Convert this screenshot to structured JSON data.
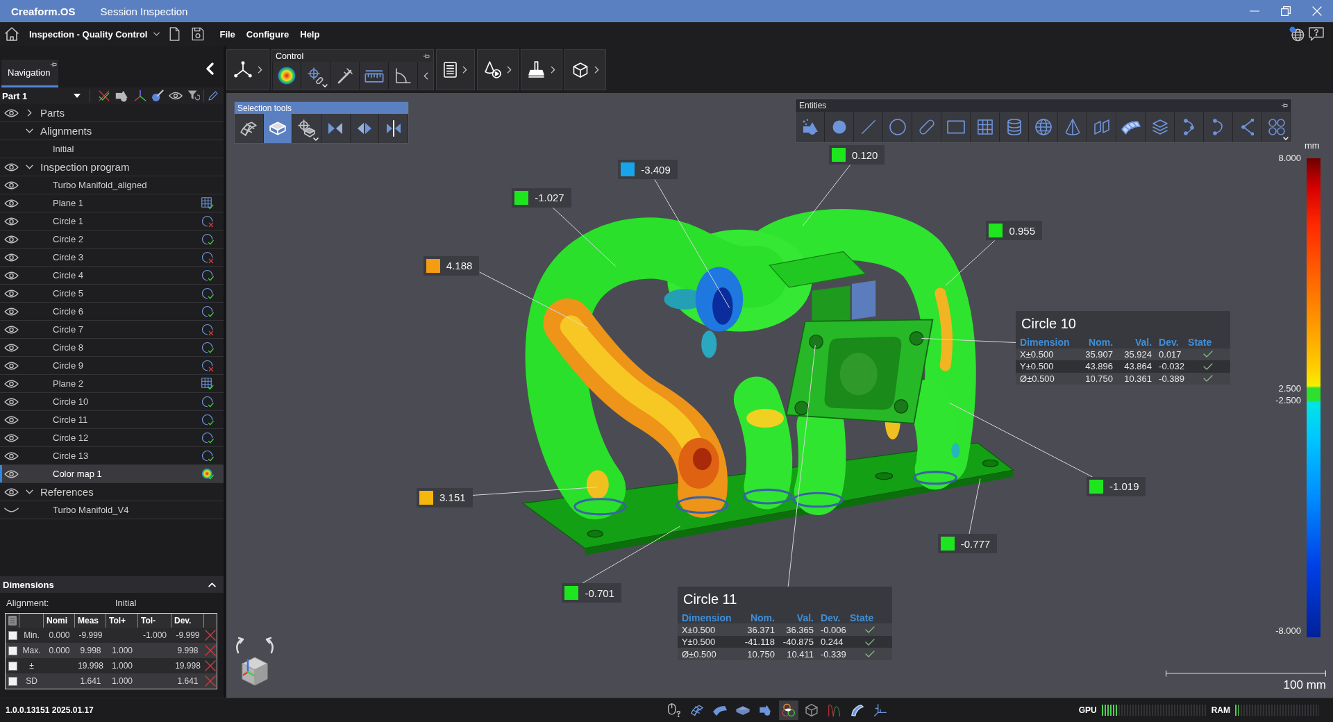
{
  "window": {
    "app_name": "Creaform.OS",
    "title": "Session Inspection"
  },
  "menu_bar": {
    "workspace": "Inspection - Quality Control",
    "menus": [
      "File",
      "Configure",
      "Help"
    ]
  },
  "toolbar": {
    "group_title": "Control"
  },
  "navigation": {
    "tabs": [
      {
        "label": "Navigation",
        "selected": true
      }
    ],
    "part": "Part 1",
    "tree": [
      {
        "label": "Parts",
        "visible": true,
        "expanded": false,
        "selected": false
      },
      {
        "label": "Alignments",
        "expanded": true,
        "selected": false,
        "children": [
          {
            "label": "Initial",
            "selected": false
          }
        ]
      },
      {
        "label": "Inspection program",
        "visible": true,
        "expanded": true,
        "selected": false,
        "children": [
          {
            "label": "Turbo Manifold_aligned",
            "visible": true,
            "selected": false
          },
          {
            "label": "Plane 1",
            "visible": true,
            "kind": "plane",
            "passed": true,
            "selected": false
          },
          {
            "label": "Circle 1",
            "visible": true,
            "kind": "circle",
            "passed": false,
            "selected": false
          },
          {
            "label": "Circle 2",
            "visible": true,
            "kind": "circle",
            "passed": true,
            "selected": false
          },
          {
            "label": "Circle 3",
            "visible": true,
            "kind": "circle",
            "passed": false,
            "selected": false
          },
          {
            "label": "Circle 4",
            "visible": true,
            "kind": "circle",
            "passed": true,
            "selected": false
          },
          {
            "label": "Circle 5",
            "visible": true,
            "kind": "circle",
            "passed": true,
            "selected": false
          },
          {
            "label": "Circle 6",
            "visible": true,
            "kind": "circle",
            "passed": true,
            "selected": false
          },
          {
            "label": "Circle 7",
            "visible": true,
            "kind": "circle",
            "passed": false,
            "selected": false
          },
          {
            "label": "Circle 8",
            "visible": true,
            "kind": "circle",
            "passed": true,
            "selected": false
          },
          {
            "label": "Circle 9",
            "visible": true,
            "kind": "circle",
            "passed": false,
            "selected": false
          },
          {
            "label": "Plane 2",
            "visible": true,
            "kind": "plane",
            "passed": true,
            "selected": false
          },
          {
            "label": "Circle 10",
            "visible": true,
            "kind": "circle",
            "passed": true,
            "selected": false
          },
          {
            "label": "Circle 11",
            "visible": true,
            "kind": "circle",
            "passed": true,
            "selected": false
          },
          {
            "label": "Circle 12",
            "visible": true,
            "kind": "circle",
            "passed": true,
            "selected": false
          },
          {
            "label": "Circle 13",
            "visible": true,
            "kind": "circle",
            "passed": true,
            "selected": false
          },
          {
            "label": "Color map 1",
            "visible": true,
            "kind": "colormap",
            "passed": true,
            "selected": true
          }
        ]
      },
      {
        "label": "References",
        "visible": true,
        "expanded": true,
        "selected": false,
        "children": [
          {
            "label": "Turbo Manifold_V4",
            "visible": false,
            "selected": false
          }
        ]
      }
    ]
  },
  "dimensions": {
    "title": "Dimensions",
    "expanded": true,
    "alignment_label": "Alignment:",
    "alignment": "Initial",
    "columns": [
      "Nomi",
      "Meas",
      "Tol+",
      "Tol-",
      "Dev."
    ],
    "rows": [
      {
        "checked": false,
        "label": "Min.",
        "nominal": "0.000",
        "measured": "-9.999",
        "tol_minus": "-1.000",
        "deviation": "-9.999",
        "passed": false
      },
      {
        "checked": false,
        "label": "Max.",
        "nominal": "0.000",
        "measured": "9.998",
        "tol_plus": "1.000",
        "deviation": "9.998",
        "passed": false
      },
      {
        "checked": false,
        "label": "±",
        "measured": "19.998",
        "tol_plus": "1.000",
        "deviation": "19.998",
        "passed": false
      },
      {
        "checked": false,
        "label": "SD",
        "measured": "1.641",
        "tol_plus": "1.000",
        "deviation": "1.641",
        "passed": false
      }
    ]
  },
  "selection_tools": {
    "title": "Selection tools",
    "tools": [
      {
        "kind": "mesh",
        "selected": false
      },
      {
        "kind": "solid",
        "selected": true
      },
      {
        "kind": "target",
        "selected": false
      },
      {
        "kind": "converge",
        "selected": false
      },
      {
        "kind": "diverge",
        "selected": false
      },
      {
        "kind": "mirror",
        "selected": false
      }
    ]
  },
  "entities": {
    "title": "Entities"
  },
  "callouts": [
    {
      "value": "0.120",
      "color": "#1ee61e"
    },
    {
      "value": "-3.409",
      "color": "#18a4ea"
    },
    {
      "value": "-1.027",
      "color": "#1ee61e"
    },
    {
      "value": "0.955",
      "color": "#1ee61e"
    },
    {
      "value": "4.188",
      "color": "#f59d12"
    },
    {
      "value": "3.151",
      "color": "#f5b70c"
    },
    {
      "value": "-1.019",
      "color": "#1ee61e"
    },
    {
      "value": "-0.777",
      "color": "#1ee61e"
    },
    {
      "value": "-0.701",
      "color": "#1ee61e"
    }
  ],
  "features": [
    {
      "title": "Circle 10",
      "columns": [
        "Dimension",
        "Nom.",
        "Val.",
        "Dev.",
        "State"
      ],
      "rows": [
        {
          "dimension": "X±0.500",
          "nominal": "35.907",
          "value": "35.924",
          "deviation": "0.017",
          "passed": true
        },
        {
          "dimension": "Y±0.500",
          "nominal": "43.896",
          "value": "43.864",
          "deviation": "-0.032",
          "passed": true
        },
        {
          "dimension": "Ø±0.500",
          "nominal": "10.750",
          "value": "10.361",
          "deviation": "-0.389",
          "passed": true
        }
      ]
    },
    {
      "title": "Circle 11",
      "columns": [
        "Dimension",
        "Nom.",
        "Val.",
        "Dev.",
        "State"
      ],
      "rows": [
        {
          "dimension": "X±0.500",
          "nominal": "36.371",
          "value": "36.365",
          "deviation": "-0.006",
          "passed": true
        },
        {
          "dimension": "Y±0.500",
          "nominal": "-41.118",
          "value": "-40.875",
          "deviation": "0.244",
          "passed": true
        },
        {
          "dimension": "Ø±0.500",
          "nominal": "10.750",
          "value": "10.411",
          "deviation": "-0.339",
          "passed": true
        }
      ]
    }
  ],
  "color_scale": {
    "unit": "mm",
    "labels": [
      "8.000",
      "2.500",
      "-2.500",
      "-8.000"
    ]
  },
  "scale_bar": {
    "label": "100 mm"
  },
  "status_bar": {
    "version": "1.0.0.13151 2025.01.17",
    "tools": [
      {
        "kind": "mouse",
        "selected": false
      },
      {
        "kind": "wire-surface",
        "selected": false
      },
      {
        "kind": "surface",
        "selected": false
      },
      {
        "kind": "slab",
        "selected": false
      },
      {
        "kind": "shapes",
        "selected": false
      },
      {
        "kind": "rings",
        "selected": true
      },
      {
        "kind": "wire-cube",
        "selected": false
      },
      {
        "kind": "curve",
        "selected": false
      },
      {
        "kind": "curved-surface",
        "selected": false
      },
      {
        "kind": "axes",
        "selected": false
      }
    ],
    "meters": [
      {
        "label": "GPU",
        "level": 0.16
      },
      {
        "label": "RAM",
        "level": 0.04
      }
    ]
  }
}
